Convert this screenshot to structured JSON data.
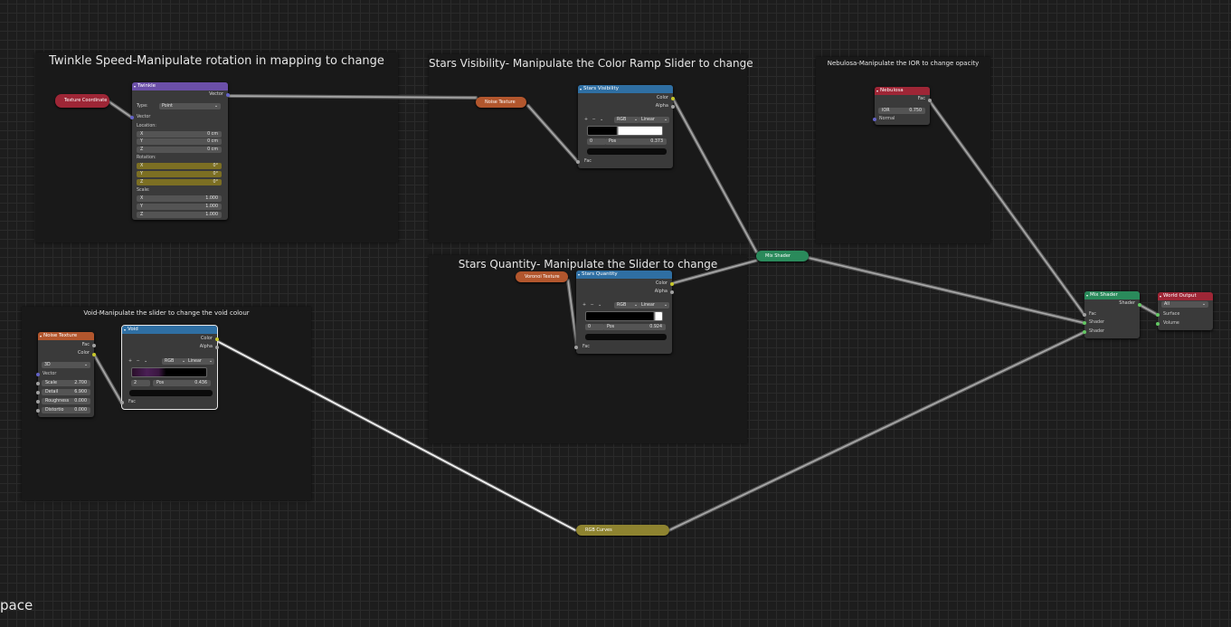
{
  "frames": {
    "twinkle": "Twinkle Speed-Manipulate rotation in mapping to change",
    "visibility": "Stars Visibility- Manipulate the Color Ramp Slider to change",
    "nebulosa": "Nebulosa-Manipulate the IOR to change opacity",
    "quantity": "Stars Quantity- Manipulate the Slider to change",
    "void": "Void-Manipulate the slider to change the void colour"
  },
  "nodes": {
    "texcoord": {
      "title": "Texture Coordinate"
    },
    "twinkle": {
      "title": "Twinkle",
      "vector_out": "Vector",
      "type_label": "Type:",
      "type_value": "Point",
      "vector_in": "Vector",
      "location": "Location:",
      "rotation": "Rotation:",
      "scale": "Scale:",
      "x": "X",
      "y": "Y",
      "z": "Z",
      "loc_x": "0 cm",
      "loc_y": "0 cm",
      "loc_z": "0 cm",
      "rot_x": "0°",
      "rot_y": "0°",
      "rot_z": "0°",
      "scale_x": "1.000",
      "scale_y": "1.000",
      "scale_z": "1.000"
    },
    "noise1": {
      "title": "Noise Texture"
    },
    "stars_visibility": {
      "title": "Stars Visibility",
      "color": "Color",
      "alpha": "Alpha",
      "mode": "RGB",
      "interp": "Linear",
      "index": "0",
      "pos_label": "Pos",
      "pos": "0.373",
      "fac": "Fac"
    },
    "nebulosa": {
      "title": "Nebulosa",
      "fac": "Fac",
      "ior_label": "IOR",
      "ior": "0.750",
      "normal": "Normal"
    },
    "voronoi": {
      "title": "Voronoi Texture"
    },
    "stars_quantity": {
      "title": "Stars Quantity",
      "color": "Color",
      "alpha": "Alpha",
      "mode": "RGB",
      "interp": "Linear",
      "index": "0",
      "pos_label": "Pos",
      "pos": "0.924",
      "fac": "Fac"
    },
    "mix1": {
      "title": "Mix Shader"
    },
    "mix2": {
      "title": "Mix Shader",
      "shader_out": "Shader",
      "fac": "Fac",
      "shader1": "Shader",
      "shader2": "Shader"
    },
    "world_output": {
      "title": "World Output",
      "target": "All",
      "surface": "Surface",
      "volume": "Volume"
    },
    "noise2": {
      "title": "Noise Texture",
      "fac": "Fac",
      "color": "Color",
      "dim": "3D",
      "vector": "Vector",
      "scale_label": "Scale",
      "scale": "2.700",
      "detail_label": "Detail",
      "detail": "6.900",
      "rough_label": "Roughness",
      "rough": "0.000",
      "distort_label": "Distortio",
      "distort": "0.000"
    },
    "void": {
      "title": "Void",
      "color": "Color",
      "alpha": "Alpha",
      "mode": "RGB",
      "interp": "Linear",
      "index": "2",
      "pos_label": "Pos",
      "pos": "0.436",
      "fac": "Fac"
    },
    "rgb_curves": {
      "title": "RGB Curves"
    }
  },
  "workspace_label": "pace",
  "colors": {
    "header_blue": "#2f6fa3",
    "header_purple": "#6b4fa8",
    "header_orange": "#b2562d",
    "header_red": "#9e2636",
    "header_green": "#2a8a5b",
    "header_yellow": "#8e8330"
  }
}
